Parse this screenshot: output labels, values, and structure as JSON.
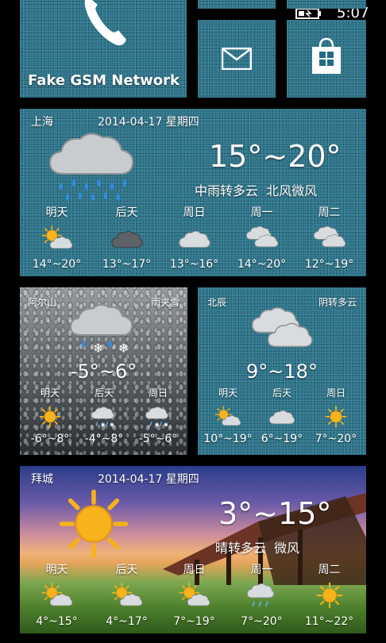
{
  "status_bar": {
    "time": "5:07"
  },
  "phone_tile": {
    "label": "Fake GSM Network"
  },
  "weather_shanghai": {
    "city": "上海",
    "date": "2014-04-17 星期四",
    "temp_range": "15°~20°",
    "description": "中雨转多云  北风微风",
    "forecast": [
      {
        "day": "明天",
        "icon": "sun-cloud-icon",
        "range": "14°~20°"
      },
      {
        "day": "后天",
        "icon": "dark-cloud-icon",
        "range": "13°~17°"
      },
      {
        "day": "周日",
        "icon": "cloud-icon",
        "range": "13°~16°"
      },
      {
        "day": "周一",
        "icon": "clouds-icon",
        "range": "14°~20°"
      },
      {
        "day": "周二",
        "icon": "clouds-icon",
        "range": "12°~19°"
      }
    ]
  },
  "weather_aershan": {
    "city": "阿尔山",
    "condition": "雨夹雪",
    "temp_range": "-5°~6°",
    "forecast": [
      {
        "day": "明天",
        "icon": "sun-icon",
        "range": "-6°~8°"
      },
      {
        "day": "后天",
        "icon": "snow-rain-icon",
        "range": "-4°~8°"
      },
      {
        "day": "周日",
        "icon": "snow-rain-icon",
        "range": "-5°~6°"
      }
    ]
  },
  "weather_beichen": {
    "city": "北辰",
    "condition": "阴转多云",
    "temp_range": "9°~18°",
    "forecast": [
      {
        "day": "明天",
        "icon": "sun-cloud-icon",
        "range": "10°~19°"
      },
      {
        "day": "后天",
        "icon": "cloud-icon",
        "range": "6°~19°"
      },
      {
        "day": "周日",
        "icon": "sun-icon",
        "range": "7°~20°"
      }
    ]
  },
  "weather_baicheng": {
    "city": "拜城",
    "date": "2014-04-17 星期四",
    "temp_range": "3°~15°",
    "description": "晴转多云  微风",
    "forecast": [
      {
        "day": "明天",
        "icon": "sun-cloud-icon",
        "range": "4°~15°"
      },
      {
        "day": "后天",
        "icon": "sun-cloud-icon",
        "range": "4°~17°"
      },
      {
        "day": "周日",
        "icon": "sun-cloud-icon",
        "range": "7°~19°"
      },
      {
        "day": "周一",
        "icon": "cloud-rain-icon",
        "range": "7°~20°"
      },
      {
        "day": "周二",
        "icon": "sun-icon",
        "range": "11°~22°"
      }
    ]
  },
  "colors": {
    "tile_teal": "#1f6c84",
    "background": "#000000"
  }
}
